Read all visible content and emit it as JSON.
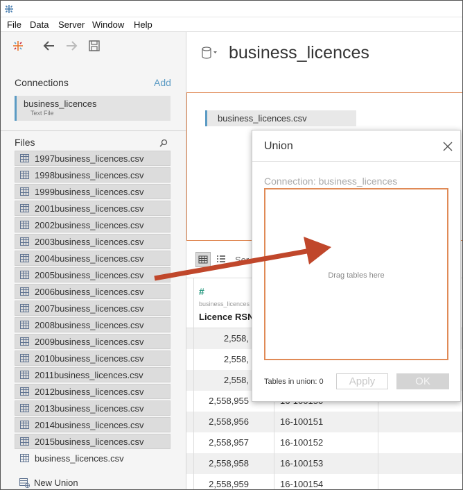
{
  "menu": [
    "File",
    "Data",
    "Server",
    "Window",
    "Help"
  ],
  "left": {
    "connections_title": "Connections",
    "add_label": "Add",
    "connection": {
      "name": "business_licences",
      "type": "Text File"
    },
    "files_title": "Files",
    "files": [
      "1997business_licences.csv",
      "1998business_licences.csv",
      "1999business_licences.csv",
      "2001business_licences.csv",
      "2002business_licences.csv",
      "2003business_licences.csv",
      "2004business_licences.csv",
      "2005business_licences.csv",
      "2006business_licences.csv",
      "2007business_licences.csv",
      "2008business_licences.csv",
      "2009business_licences.csv",
      "2010business_licences.csv",
      "2011business_licences.csv",
      "2012business_licences.csv",
      "2013business_licences.csv",
      "2014business_licences.csv",
      "2015business_licences.csv",
      "business_licences.csv"
    ],
    "new_union": "New Union"
  },
  "main": {
    "datasource_title": "business_licences",
    "canvas_table": "business_licences.csv",
    "sort_label": "Sor",
    "grid": {
      "column_source": "business_licences",
      "column_name": "Licence RSN",
      "rows": [
        {
          "rsn": "2,558,",
          "num": ""
        },
        {
          "rsn": "2,558,",
          "num": ""
        },
        {
          "rsn": "2,558,",
          "num": ""
        },
        {
          "rsn": "2,558,955",
          "num": "16-100150"
        },
        {
          "rsn": "2,558,956",
          "num": "16-100151"
        },
        {
          "rsn": "2,558,957",
          "num": "16-100152"
        },
        {
          "rsn": "2,558,958",
          "num": "16-100153"
        },
        {
          "rsn": "2,558,959",
          "num": "16-100154"
        }
      ]
    }
  },
  "dialog": {
    "title": "Union",
    "connection_label": "Connection: business_licences",
    "drop_text": "Drag tables here",
    "tables_count": "Tables in union: 0",
    "apply_label": "Apply",
    "ok_label": "OK"
  },
  "colors": {
    "accent": "#5b9bc4",
    "drop_border": "#e08a56",
    "arrow": "#c0472b"
  }
}
